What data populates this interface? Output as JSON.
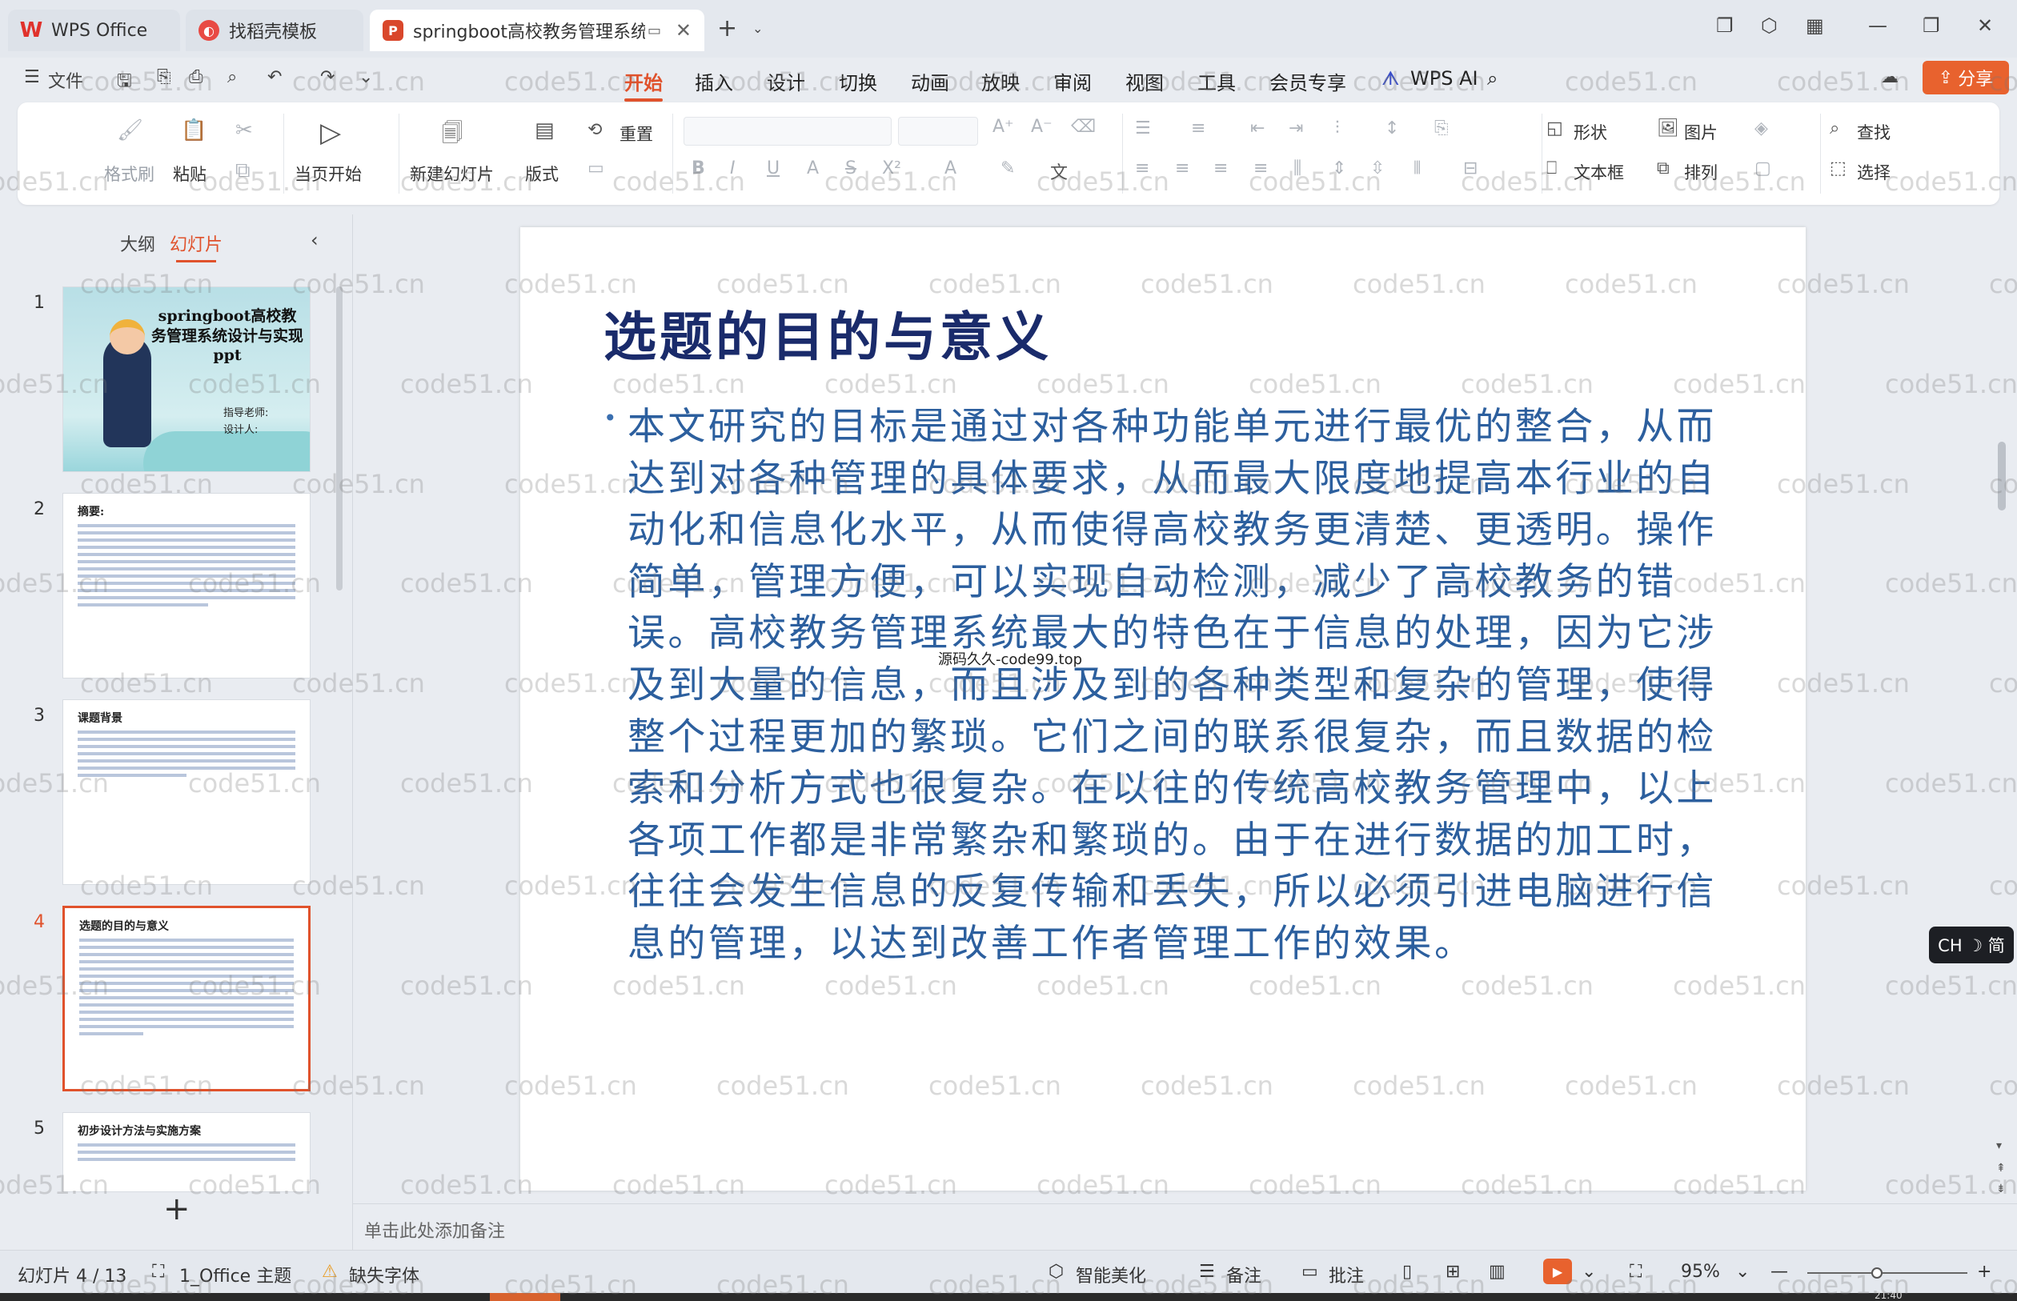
{
  "tabs": {
    "wps_office": "WPS Office",
    "templates": "找稻壳模板",
    "document": "springboot高校教务管理系统"
  },
  "menubar": {
    "file": "文件",
    "items": [
      "开始",
      "插入",
      "设计",
      "切换",
      "动画",
      "放映",
      "审阅",
      "视图",
      "工具",
      "会员专享"
    ],
    "active": "开始",
    "wps_ai": "WPS AI",
    "share": "分享"
  },
  "ribbon": {
    "format_painter": "格式刷",
    "paste": "粘贴",
    "play_from_current": "当页开始",
    "new_slide": "新建幻灯片",
    "layout": "版式",
    "reset": "重置",
    "shape": "形状",
    "picture": "图片",
    "find": "查找",
    "textbox": "文本框",
    "arrange": "排列",
    "select": "选择"
  },
  "panel": {
    "outline_tab": "大纲",
    "slides_tab": "幻灯片",
    "add_slide": "+"
  },
  "thumbnails": [
    {
      "num": "1",
      "title": "springboot高校教务管理系统设计与实现ppt",
      "sub1": "指导老师:",
      "sub2": "设计人:"
    },
    {
      "num": "2",
      "title": "摘要:"
    },
    {
      "num": "3",
      "title": "课题背景"
    },
    {
      "num": "4",
      "title": "选题的目的与意义"
    },
    {
      "num": "5",
      "title": "初步设计方法与实施方案"
    }
  ],
  "slide": {
    "title": "选题的目的与意义",
    "body": "本文研究的目标是通过对各种功能单元进行最优的整合，从而达到对各种管理的具体要求，从而最大限度地提高本行业的自动化和信息化水平，从而使得高校教务更清楚、更透明。操作简单，管理方便，可以实现自动检测，减少了高校教务的错误。高校教务管理系统最大的特色在于信息的处理，因为它涉及到大量的信息，而且涉及到的各种类型和复杂的管理，使得整个过程更加的繁琐。它们之间的联系很复杂，而且数据的检索和分析方式也很复杂。在以往的传统高校教务管理中，以上各项工作都是非常繁杂和繁琐的。由于在进行数据的加工时，往往会发生信息的反复传输和丢失，所以必须引进电脑进行信息的管理，以达到改善工作者管理工作的效果。",
    "watermark_center": "源码久久-code99.top"
  },
  "notes_placeholder": "单击此处添加备注",
  "ime_badge": "CH ☽ 简",
  "statusbar": {
    "slide_counter": "幻灯片 4 / 13",
    "theme": "1_Office 主题",
    "missing_font": "缺失字体",
    "smart_beautify": "智能美化",
    "notes": "备注",
    "comments": "批注",
    "zoom": "95%",
    "clock_partial": "21:40"
  },
  "watermark_text": "code51.cn",
  "colors": {
    "accent": "#e0522c",
    "title_text": "#1a2b6b",
    "body_text": "#2c5f9e",
    "share_button": "#e8622e"
  }
}
